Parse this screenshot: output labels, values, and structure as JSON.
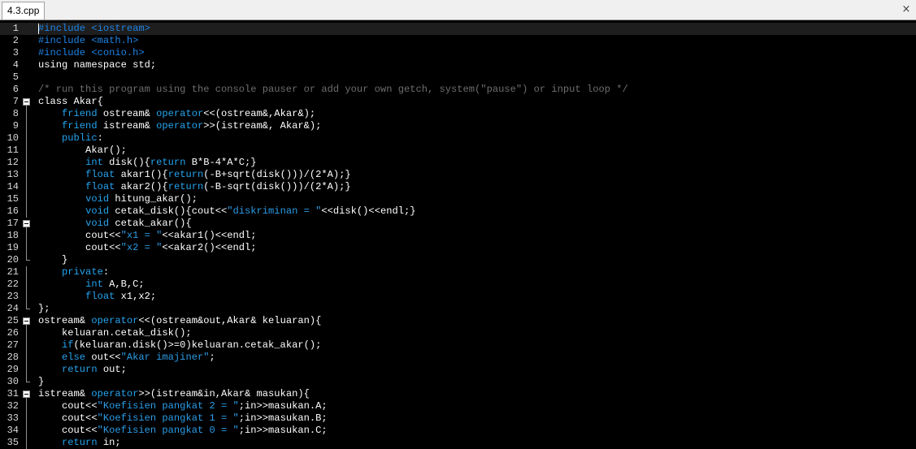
{
  "tab": {
    "title": "4.3.cpp",
    "close_glyph": "×"
  },
  "colors": {
    "editor_bg": "#000000",
    "preprocessor": "#1e84e6",
    "comment": "#6e6e6e",
    "keyword": "#25a4ef",
    "string": "#2c9ce6",
    "text": "#ffffff",
    "line_number": "#d8d8d8"
  },
  "editor": {
    "current_line": 1,
    "lines": [
      {
        "n": "1",
        "fold": "",
        "tokens": [
          [
            "pre",
            "#include <iostream>"
          ]
        ]
      },
      {
        "n": "2",
        "fold": "",
        "tokens": [
          [
            "pre",
            "#include <math.h>"
          ]
        ]
      },
      {
        "n": "3",
        "fold": "",
        "tokens": [
          [
            "pre",
            "#include <conio.h>"
          ]
        ]
      },
      {
        "n": "4",
        "fold": "",
        "tokens": [
          [
            "txt",
            "using namespace std;"
          ]
        ]
      },
      {
        "n": "5",
        "fold": "",
        "tokens": []
      },
      {
        "n": "6",
        "fold": "",
        "tokens": [
          [
            "com",
            "/* run this program using the console pauser or add your own getch, system(\"pause\") or input loop */"
          ]
        ]
      },
      {
        "n": "7",
        "fold": "open",
        "tokens": [
          [
            "txt",
            "class Akar{"
          ]
        ]
      },
      {
        "n": "8",
        "fold": "line",
        "tokens": [
          [
            "txt",
            "    "
          ],
          [
            "kw",
            "friend"
          ],
          [
            "txt",
            " ostream& "
          ],
          [
            "kw",
            "operator"
          ],
          [
            "txt",
            "<<(ostream&,Akar&);"
          ]
        ]
      },
      {
        "n": "9",
        "fold": "line",
        "tokens": [
          [
            "txt",
            "    "
          ],
          [
            "kw",
            "friend"
          ],
          [
            "txt",
            " istream& "
          ],
          [
            "kw",
            "operator"
          ],
          [
            "txt",
            ">>(istream&, Akar&);"
          ]
        ]
      },
      {
        "n": "10",
        "fold": "line",
        "tokens": [
          [
            "txt",
            "    "
          ],
          [
            "kw",
            "public"
          ],
          [
            "txt",
            ":"
          ]
        ]
      },
      {
        "n": "11",
        "fold": "line",
        "tokens": [
          [
            "txt",
            "        Akar();"
          ]
        ]
      },
      {
        "n": "12",
        "fold": "line",
        "tokens": [
          [
            "txt",
            "        "
          ],
          [
            "kw",
            "int"
          ],
          [
            "txt",
            " disk(){"
          ],
          [
            "kw",
            "return"
          ],
          [
            "txt",
            " B*B-4*A*C;}"
          ]
        ]
      },
      {
        "n": "13",
        "fold": "line",
        "tokens": [
          [
            "txt",
            "        "
          ],
          [
            "kw",
            "float"
          ],
          [
            "txt",
            " akar1(){"
          ],
          [
            "kw",
            "return"
          ],
          [
            "txt",
            "(-B+sqrt(disk()))/(2*A);}"
          ]
        ]
      },
      {
        "n": "14",
        "fold": "line",
        "tokens": [
          [
            "txt",
            "        "
          ],
          [
            "kw",
            "float"
          ],
          [
            "txt",
            " akar2(){"
          ],
          [
            "kw",
            "return"
          ],
          [
            "txt",
            "(-B-sqrt(disk()))/(2*A);}"
          ]
        ]
      },
      {
        "n": "15",
        "fold": "line",
        "tokens": [
          [
            "txt",
            "        "
          ],
          [
            "kw",
            "void"
          ],
          [
            "txt",
            " hitung_akar();"
          ]
        ]
      },
      {
        "n": "16",
        "fold": "line",
        "tokens": [
          [
            "txt",
            "        "
          ],
          [
            "kw",
            "void"
          ],
          [
            "txt",
            " cetak_disk(){cout<<"
          ],
          [
            "str",
            "\"diskriminan = \""
          ],
          [
            "txt",
            "<<disk()<<endl;}"
          ]
        ]
      },
      {
        "n": "17",
        "fold": "open",
        "tokens": [
          [
            "txt",
            "        "
          ],
          [
            "kw",
            "void"
          ],
          [
            "txt",
            " cetak_akar(){"
          ]
        ]
      },
      {
        "n": "18",
        "fold": "line",
        "tokens": [
          [
            "txt",
            "        cout<<"
          ],
          [
            "str",
            "\"x1 = \""
          ],
          [
            "txt",
            "<<akar1()<<endl;"
          ]
        ]
      },
      {
        "n": "19",
        "fold": "line",
        "tokens": [
          [
            "txt",
            "        cout<<"
          ],
          [
            "str",
            "\"x2 = \""
          ],
          [
            "txt",
            "<<akar2()<<endl;"
          ]
        ]
      },
      {
        "n": "20",
        "fold": "end",
        "tokens": [
          [
            "txt",
            "    }"
          ]
        ]
      },
      {
        "n": "21",
        "fold": "line",
        "tokens": [
          [
            "txt",
            "    "
          ],
          [
            "kw",
            "private"
          ],
          [
            "txt",
            ":"
          ]
        ]
      },
      {
        "n": "22",
        "fold": "line",
        "tokens": [
          [
            "txt",
            "        "
          ],
          [
            "kw",
            "int"
          ],
          [
            "txt",
            " A,B,C;"
          ]
        ]
      },
      {
        "n": "23",
        "fold": "line",
        "tokens": [
          [
            "txt",
            "        "
          ],
          [
            "kw",
            "float"
          ],
          [
            "txt",
            " x1,x2;"
          ]
        ]
      },
      {
        "n": "24",
        "fold": "end",
        "tokens": [
          [
            "txt",
            "};"
          ]
        ]
      },
      {
        "n": "25",
        "fold": "open",
        "tokens": [
          [
            "txt",
            "ostream& "
          ],
          [
            "kw",
            "operator"
          ],
          [
            "txt",
            "<<(ostream&out,Akar& keluaran){"
          ]
        ]
      },
      {
        "n": "26",
        "fold": "line",
        "tokens": [
          [
            "txt",
            "    keluaran.cetak_disk();"
          ]
        ]
      },
      {
        "n": "27",
        "fold": "line",
        "tokens": [
          [
            "txt",
            "    "
          ],
          [
            "kw",
            "if"
          ],
          [
            "txt",
            "(keluaran.disk()>=0)keluaran.cetak_akar();"
          ]
        ]
      },
      {
        "n": "28",
        "fold": "line",
        "tokens": [
          [
            "txt",
            "    "
          ],
          [
            "kw",
            "else"
          ],
          [
            "txt",
            " out<<"
          ],
          [
            "str",
            "\"Akar imajiner\""
          ],
          [
            "txt",
            ";"
          ]
        ]
      },
      {
        "n": "29",
        "fold": "line",
        "tokens": [
          [
            "txt",
            "    "
          ],
          [
            "kw",
            "return"
          ],
          [
            "txt",
            " out;"
          ]
        ]
      },
      {
        "n": "30",
        "fold": "end",
        "tokens": [
          [
            "txt",
            "}"
          ]
        ]
      },
      {
        "n": "31",
        "fold": "open",
        "tokens": [
          [
            "txt",
            "istream& "
          ],
          [
            "kw",
            "operator"
          ],
          [
            "txt",
            ">>(istream&in,Akar& masukan){"
          ]
        ]
      },
      {
        "n": "32",
        "fold": "line",
        "tokens": [
          [
            "txt",
            "    cout<<"
          ],
          [
            "str",
            "\"Koefisien pangkat 2 = \""
          ],
          [
            "txt",
            ";in>>masukan.A;"
          ]
        ]
      },
      {
        "n": "33",
        "fold": "line",
        "tokens": [
          [
            "txt",
            "    cout<<"
          ],
          [
            "str",
            "\"Koefisien pangkat 1 = \""
          ],
          [
            "txt",
            ";in>>masukan.B;"
          ]
        ]
      },
      {
        "n": "34",
        "fold": "line",
        "tokens": [
          [
            "txt",
            "    cout<<"
          ],
          [
            "str",
            "\"Koefisien pangkat 0 = \""
          ],
          [
            "txt",
            ";in>>masukan.C;"
          ]
        ]
      },
      {
        "n": "35",
        "fold": "line",
        "tokens": [
          [
            "txt",
            "    "
          ],
          [
            "kw",
            "return"
          ],
          [
            "txt",
            " in;"
          ]
        ]
      }
    ]
  }
}
